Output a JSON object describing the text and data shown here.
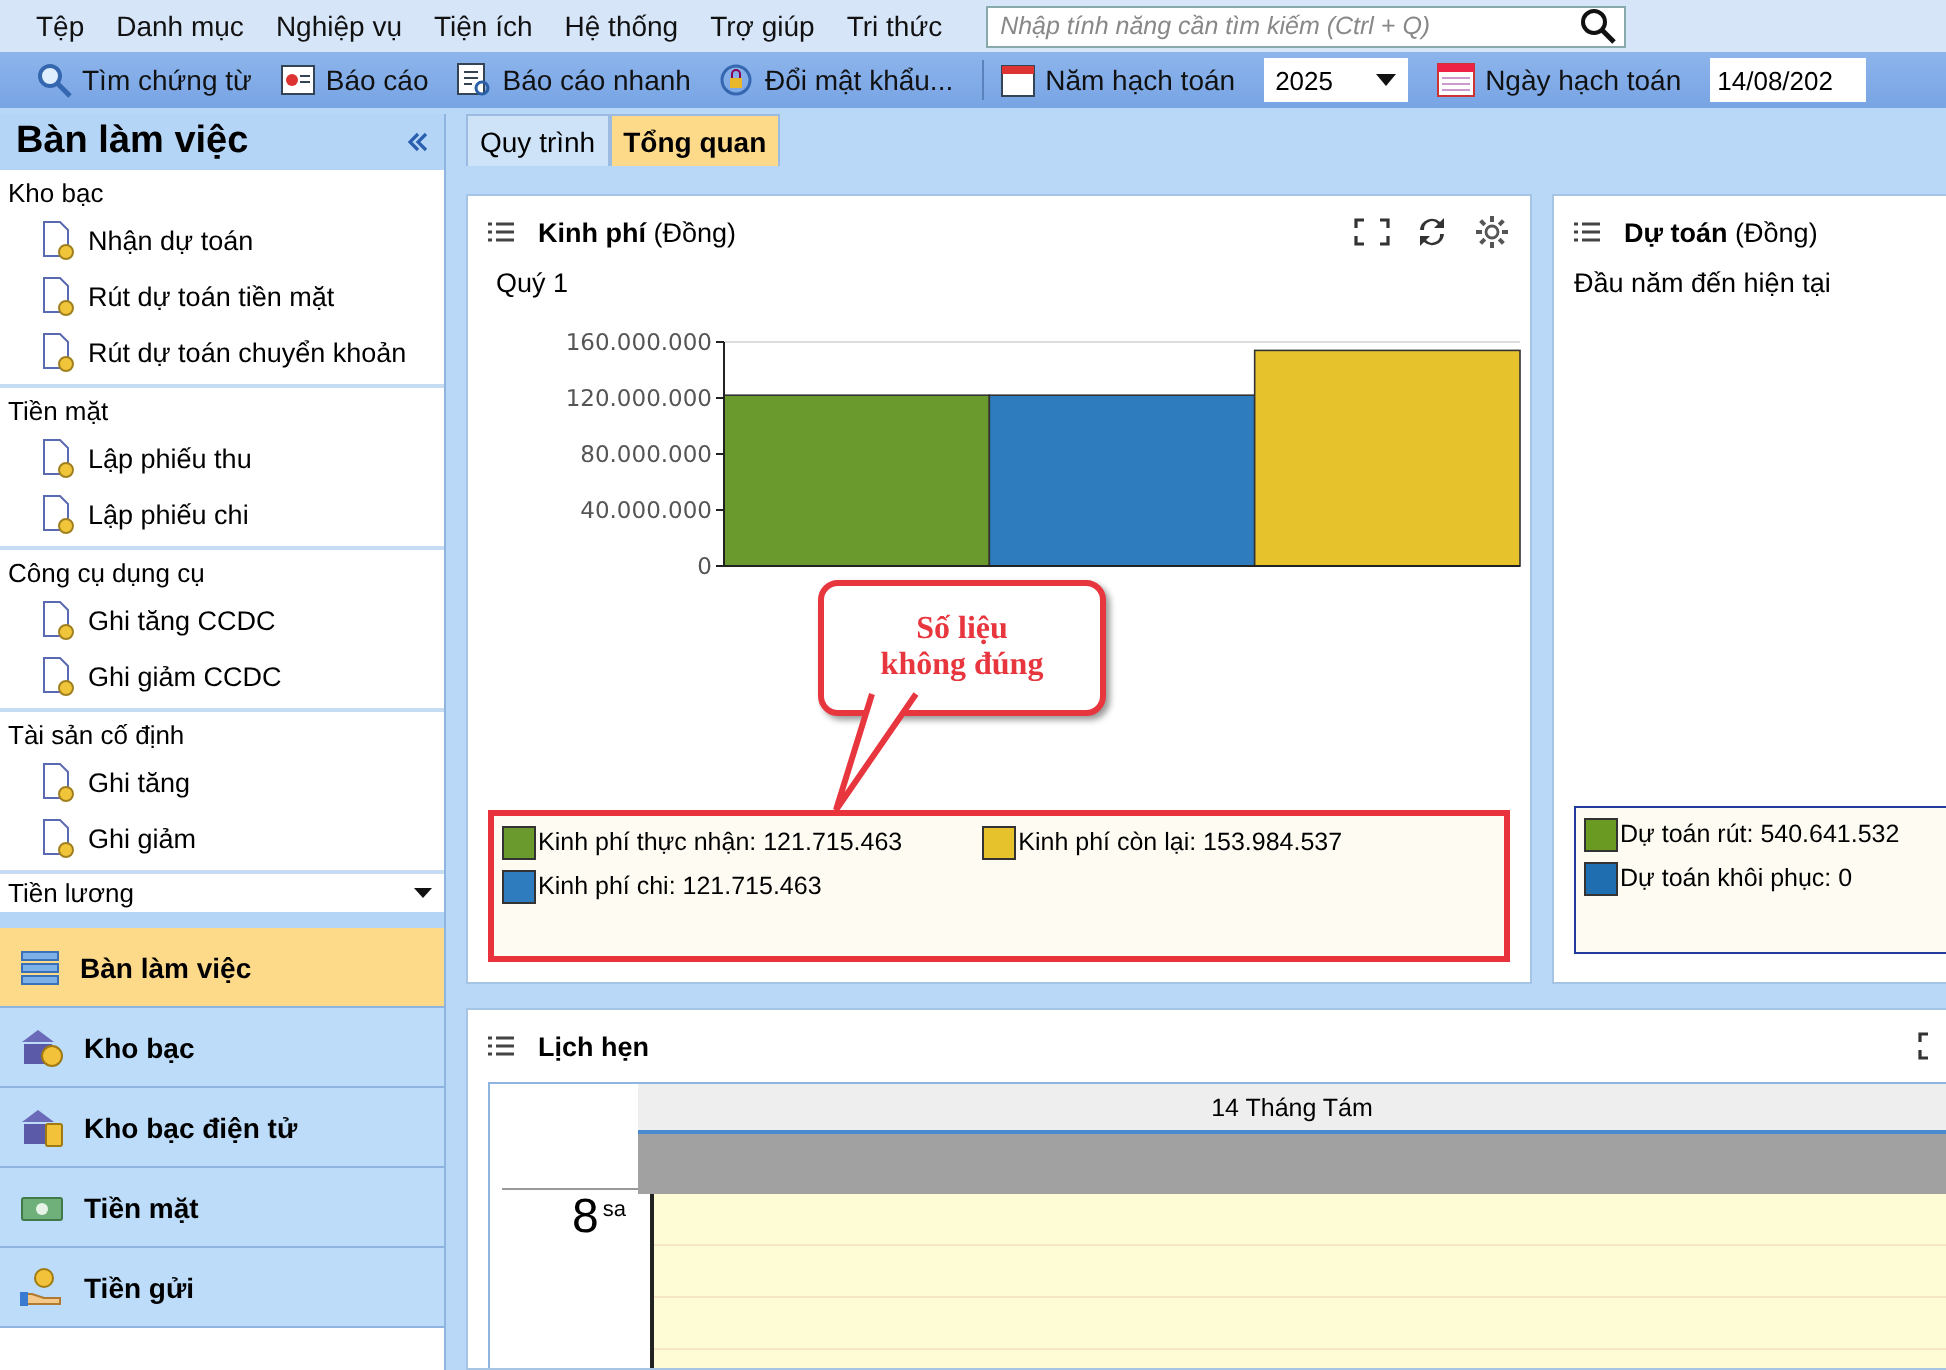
{
  "menu": [
    "Tệp",
    "Danh mục",
    "Nghiệp vụ",
    "Tiện ích",
    "Hệ thống",
    "Trợ giúp",
    "Tri thức"
  ],
  "search": {
    "placeholder": "Nhập tính năng cần tìm kiếm (Ctrl + Q)"
  },
  "toolbar": [
    {
      "kind": "search",
      "label": "Tìm chứng từ"
    },
    {
      "kind": "report",
      "label": "Báo cáo"
    },
    {
      "kind": "quick",
      "label": "Báo cáo nhanh"
    },
    {
      "kind": "lock",
      "label": "Đổi mật khẩu..."
    }
  ],
  "year": {
    "label": "Năm hạch toán",
    "value": "2025"
  },
  "date": {
    "label": "Ngày hạch toán",
    "value": "14/08/202"
  },
  "sidebar": {
    "title": "Bàn làm việc",
    "groups": [
      {
        "title": "Kho bạc",
        "items": [
          "Nhận dự toán",
          "Rút dự toán tiền mặt",
          "Rút dự toán chuyển khoản"
        ]
      },
      {
        "title": "Tiền mặt",
        "items": [
          "Lập phiếu thu",
          "Lập phiếu chi"
        ]
      },
      {
        "title": "Công cụ dụng cụ",
        "items": [
          "Ghi tăng CCDC",
          "Ghi giảm CCDC"
        ]
      },
      {
        "title": "Tài sản cố định",
        "items": [
          "Ghi tăng",
          "Ghi giảm"
        ]
      }
    ],
    "collapsed_group": "Tiền lương",
    "nav": [
      {
        "kind": "desk",
        "label": "Bàn làm việc",
        "selected": true
      },
      {
        "kind": "bank",
        "label": "Kho bạc",
        "selected": false
      },
      {
        "kind": "ebank",
        "label": "Kho bạc điện tử",
        "selected": false
      },
      {
        "kind": "cash",
        "label": "Tiền mặt",
        "selected": false
      },
      {
        "kind": "deposit",
        "label": "Tiền gửi",
        "selected": false
      }
    ]
  },
  "tabs": [
    {
      "label": "Quy trình",
      "selected": false
    },
    {
      "label": "Tổng quan",
      "selected": true
    }
  ],
  "budget_panel": {
    "title": "Kinh phí",
    "unit": "(Đồng)",
    "period": "Quý 1",
    "chart_data": {
      "type": "bar",
      "series": [
        {
          "name": "Kinh phí thực nhận: 121.715.463",
          "color": "#6a9a2e",
          "values": [
            122000000
          ]
        },
        {
          "name": "Kinh phí chi: 121.715.463",
          "color": "#2e7bbd",
          "values": [
            122000000
          ]
        },
        {
          "name": "Kinh phí còn lại: 153.984.537",
          "color": "#e6c22c",
          "values": [
            154000000
          ]
        }
      ],
      "ylim": [
        0,
        160000000
      ],
      "yticks": [
        {
          "value": 0,
          "label": "0"
        },
        {
          "value": 40000000,
          "label": "40.000.000"
        },
        {
          "value": 80000000,
          "label": "80.000.000"
        },
        {
          "value": 120000000,
          "label": "120.000.000"
        },
        {
          "value": 160000000,
          "label": "160.000.000"
        }
      ]
    },
    "legend_highlighted": true,
    "callout": [
      "Số liệu",
      "không đúng"
    ]
  },
  "estimate_panel": {
    "title": "Dự toán",
    "unit": "(Đồng)",
    "period": "Đầu năm đến hiện tại",
    "legend": [
      {
        "label": "Dự toán rút: 540.641.532",
        "color": "#6a9a22"
      },
      {
        "label": "Dự toán khôi phục: 0",
        "color": "#1f6fb0"
      }
    ]
  },
  "calendar": {
    "title": "Lịch hẹn",
    "day": "14 Tháng Tám",
    "hour": "8",
    "suffix": "sa"
  }
}
